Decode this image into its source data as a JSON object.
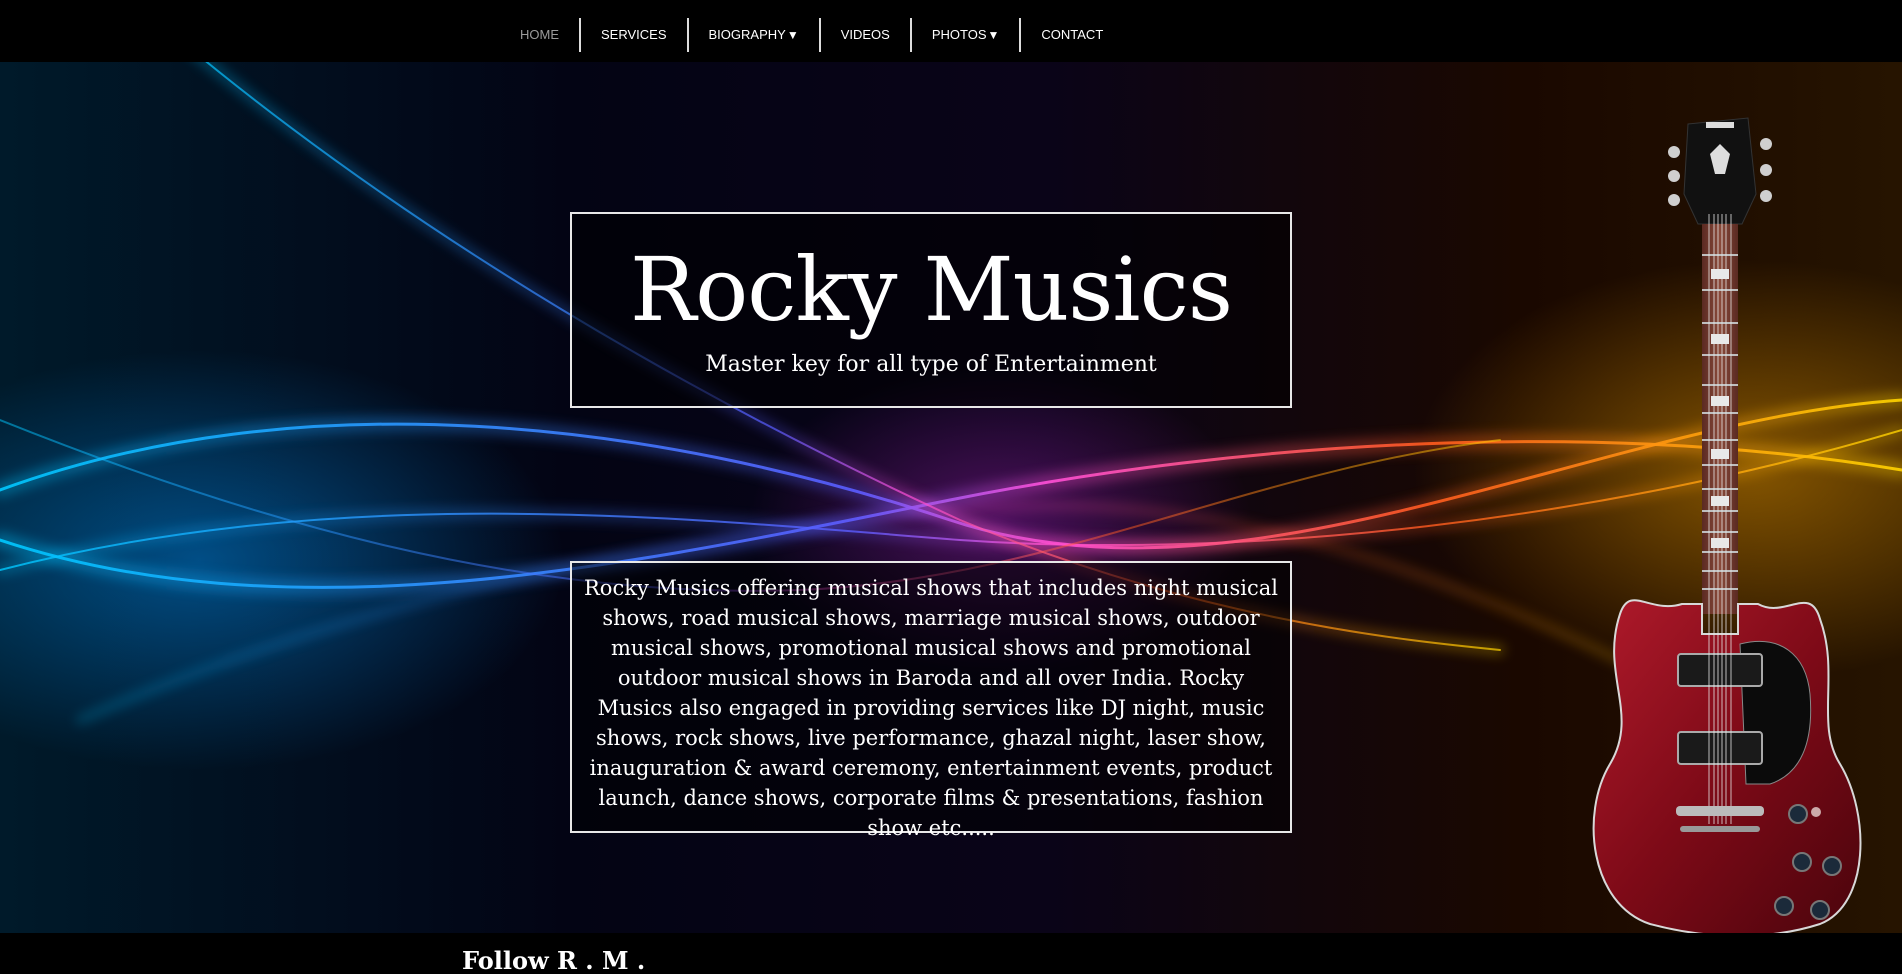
{
  "nav": {
    "items": [
      {
        "label": "HOME",
        "active": true
      },
      {
        "label": "SERVICES"
      },
      {
        "label": "BIOGRAPHY",
        "caret": "▼"
      },
      {
        "label": "VIDEOS"
      },
      {
        "label": "PHOTOS",
        "caret": "▼"
      },
      {
        "label": "CONTACT"
      }
    ]
  },
  "hero": {
    "title": "Rocky Musics",
    "subtitle": "Master key for all type of Entertainment"
  },
  "description": "Rocky Musics offering musical shows that includes night musical shows, road musical shows, marriage musical shows, outdoor musical shows, promotional musical shows and promotional outdoor musical shows in Baroda and all over India. Rocky Musics also engaged in providing services like DJ night, music shows, rock shows, live performance, ghazal night, laser show, inauguration & award ceremony, entertainment events, product launch, dance shows, corporate films & presentations, fashion show etc.....",
  "footer": {
    "follow": "Follow R . M ."
  },
  "colors": {
    "nav_bg": "#000000",
    "active_nav": "#9a9a9a",
    "text": "#ffffff",
    "guitar_body": "#8b0d1c"
  }
}
